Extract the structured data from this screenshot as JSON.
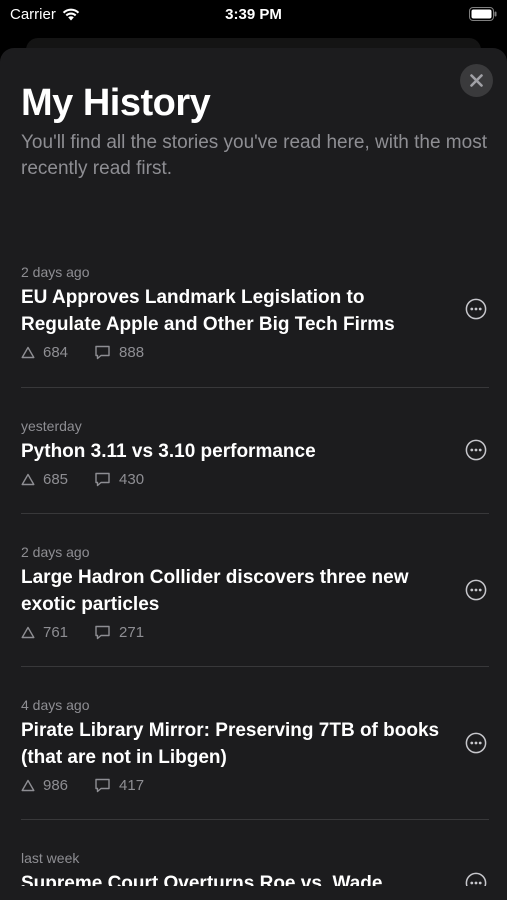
{
  "status": {
    "carrier": "Carrier",
    "time": "3:39 PM"
  },
  "header": {
    "title": "My History",
    "subtitle": "You'll find all the stories you've read here, with the most recently read first."
  },
  "stories": [
    {
      "when": "2 days ago",
      "title": "EU Approves Landmark Legislation to Regulate Apple and Other Big Tech Firms",
      "points": "684",
      "comments": "888"
    },
    {
      "when": "yesterday",
      "title": "Python 3.11 vs 3.10 performance",
      "points": "685",
      "comments": "430"
    },
    {
      "when": "2 days ago",
      "title": "Large Hadron Collider discovers three new exotic particles",
      "points": "761",
      "comments": "271"
    },
    {
      "when": "4 days ago",
      "title": "Pirate Library Mirror: Preserving 7TB of books (that are not in Libgen)",
      "points": "986",
      "comments": "417"
    },
    {
      "when": "last week",
      "title": "Supreme Court Overturns Roe vs. Wade",
      "points": "",
      "comments": ""
    }
  ],
  "colors": {
    "sheet": "#1c1c1e",
    "secondary_text": "#8e8e93",
    "divider": "#38383a"
  }
}
